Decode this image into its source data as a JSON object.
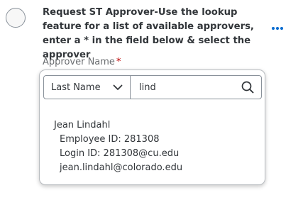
{
  "question": {
    "text": "Request ST Approver-Use the lookup feature for a list of available approvers, enter a * in the field below & select the approver"
  },
  "field": {
    "label": "Approver Name",
    "required_marker": "*"
  },
  "search": {
    "filter_value": "Last Name",
    "query": "lind"
  },
  "results": [
    {
      "name": "Jean Lindahl",
      "employee_id": "Employee ID: 281308",
      "login_id": "Login ID: 281308@cu.edu",
      "email": "jean.lindahl@colorado.edu"
    }
  ],
  "icons": {
    "more": "more-horizontal-icon",
    "dropdown": "chevron-down-icon",
    "search": "search-icon"
  },
  "colors": {
    "accent": "#0a6ed1",
    "required": "#bb0000",
    "text": "#32363a",
    "label": "#6a6d70"
  }
}
